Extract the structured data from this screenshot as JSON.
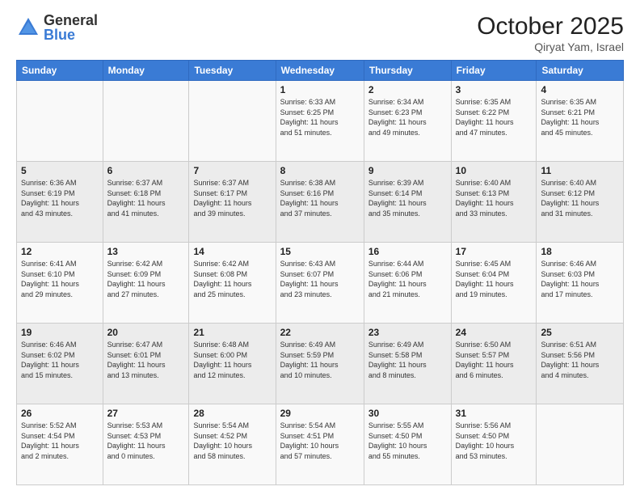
{
  "logo": {
    "general": "General",
    "blue": "Blue"
  },
  "title": "October 2025",
  "location": "Qiryat Yam, Israel",
  "weekdays": [
    "Sunday",
    "Monday",
    "Tuesday",
    "Wednesday",
    "Thursday",
    "Friday",
    "Saturday"
  ],
  "weeks": [
    [
      {
        "day": "",
        "info": ""
      },
      {
        "day": "",
        "info": ""
      },
      {
        "day": "",
        "info": ""
      },
      {
        "day": "1",
        "info": "Sunrise: 6:33 AM\nSunset: 6:25 PM\nDaylight: 11 hours\nand 51 minutes."
      },
      {
        "day": "2",
        "info": "Sunrise: 6:34 AM\nSunset: 6:23 PM\nDaylight: 11 hours\nand 49 minutes."
      },
      {
        "day": "3",
        "info": "Sunrise: 6:35 AM\nSunset: 6:22 PM\nDaylight: 11 hours\nand 47 minutes."
      },
      {
        "day": "4",
        "info": "Sunrise: 6:35 AM\nSunset: 6:21 PM\nDaylight: 11 hours\nand 45 minutes."
      }
    ],
    [
      {
        "day": "5",
        "info": "Sunrise: 6:36 AM\nSunset: 6:19 PM\nDaylight: 11 hours\nand 43 minutes."
      },
      {
        "day": "6",
        "info": "Sunrise: 6:37 AM\nSunset: 6:18 PM\nDaylight: 11 hours\nand 41 minutes."
      },
      {
        "day": "7",
        "info": "Sunrise: 6:37 AM\nSunset: 6:17 PM\nDaylight: 11 hours\nand 39 minutes."
      },
      {
        "day": "8",
        "info": "Sunrise: 6:38 AM\nSunset: 6:16 PM\nDaylight: 11 hours\nand 37 minutes."
      },
      {
        "day": "9",
        "info": "Sunrise: 6:39 AM\nSunset: 6:14 PM\nDaylight: 11 hours\nand 35 minutes."
      },
      {
        "day": "10",
        "info": "Sunrise: 6:40 AM\nSunset: 6:13 PM\nDaylight: 11 hours\nand 33 minutes."
      },
      {
        "day": "11",
        "info": "Sunrise: 6:40 AM\nSunset: 6:12 PM\nDaylight: 11 hours\nand 31 minutes."
      }
    ],
    [
      {
        "day": "12",
        "info": "Sunrise: 6:41 AM\nSunset: 6:10 PM\nDaylight: 11 hours\nand 29 minutes."
      },
      {
        "day": "13",
        "info": "Sunrise: 6:42 AM\nSunset: 6:09 PM\nDaylight: 11 hours\nand 27 minutes."
      },
      {
        "day": "14",
        "info": "Sunrise: 6:42 AM\nSunset: 6:08 PM\nDaylight: 11 hours\nand 25 minutes."
      },
      {
        "day": "15",
        "info": "Sunrise: 6:43 AM\nSunset: 6:07 PM\nDaylight: 11 hours\nand 23 minutes."
      },
      {
        "day": "16",
        "info": "Sunrise: 6:44 AM\nSunset: 6:06 PM\nDaylight: 11 hours\nand 21 minutes."
      },
      {
        "day": "17",
        "info": "Sunrise: 6:45 AM\nSunset: 6:04 PM\nDaylight: 11 hours\nand 19 minutes."
      },
      {
        "day": "18",
        "info": "Sunrise: 6:46 AM\nSunset: 6:03 PM\nDaylight: 11 hours\nand 17 minutes."
      }
    ],
    [
      {
        "day": "19",
        "info": "Sunrise: 6:46 AM\nSunset: 6:02 PM\nDaylight: 11 hours\nand 15 minutes."
      },
      {
        "day": "20",
        "info": "Sunrise: 6:47 AM\nSunset: 6:01 PM\nDaylight: 11 hours\nand 13 minutes."
      },
      {
        "day": "21",
        "info": "Sunrise: 6:48 AM\nSunset: 6:00 PM\nDaylight: 11 hours\nand 12 minutes."
      },
      {
        "day": "22",
        "info": "Sunrise: 6:49 AM\nSunset: 5:59 PM\nDaylight: 11 hours\nand 10 minutes."
      },
      {
        "day": "23",
        "info": "Sunrise: 6:49 AM\nSunset: 5:58 PM\nDaylight: 11 hours\nand 8 minutes."
      },
      {
        "day": "24",
        "info": "Sunrise: 6:50 AM\nSunset: 5:57 PM\nDaylight: 11 hours\nand 6 minutes."
      },
      {
        "day": "25",
        "info": "Sunrise: 6:51 AM\nSunset: 5:56 PM\nDaylight: 11 hours\nand 4 minutes."
      }
    ],
    [
      {
        "day": "26",
        "info": "Sunrise: 5:52 AM\nSunset: 4:54 PM\nDaylight: 11 hours\nand 2 minutes."
      },
      {
        "day": "27",
        "info": "Sunrise: 5:53 AM\nSunset: 4:53 PM\nDaylight: 11 hours\nand 0 minutes."
      },
      {
        "day": "28",
        "info": "Sunrise: 5:54 AM\nSunset: 4:52 PM\nDaylight: 10 hours\nand 58 minutes."
      },
      {
        "day": "29",
        "info": "Sunrise: 5:54 AM\nSunset: 4:51 PM\nDaylight: 10 hours\nand 57 minutes."
      },
      {
        "day": "30",
        "info": "Sunrise: 5:55 AM\nSunset: 4:50 PM\nDaylight: 10 hours\nand 55 minutes."
      },
      {
        "day": "31",
        "info": "Sunrise: 5:56 AM\nSunset: 4:50 PM\nDaylight: 10 hours\nand 53 minutes."
      },
      {
        "day": "",
        "info": ""
      }
    ]
  ]
}
